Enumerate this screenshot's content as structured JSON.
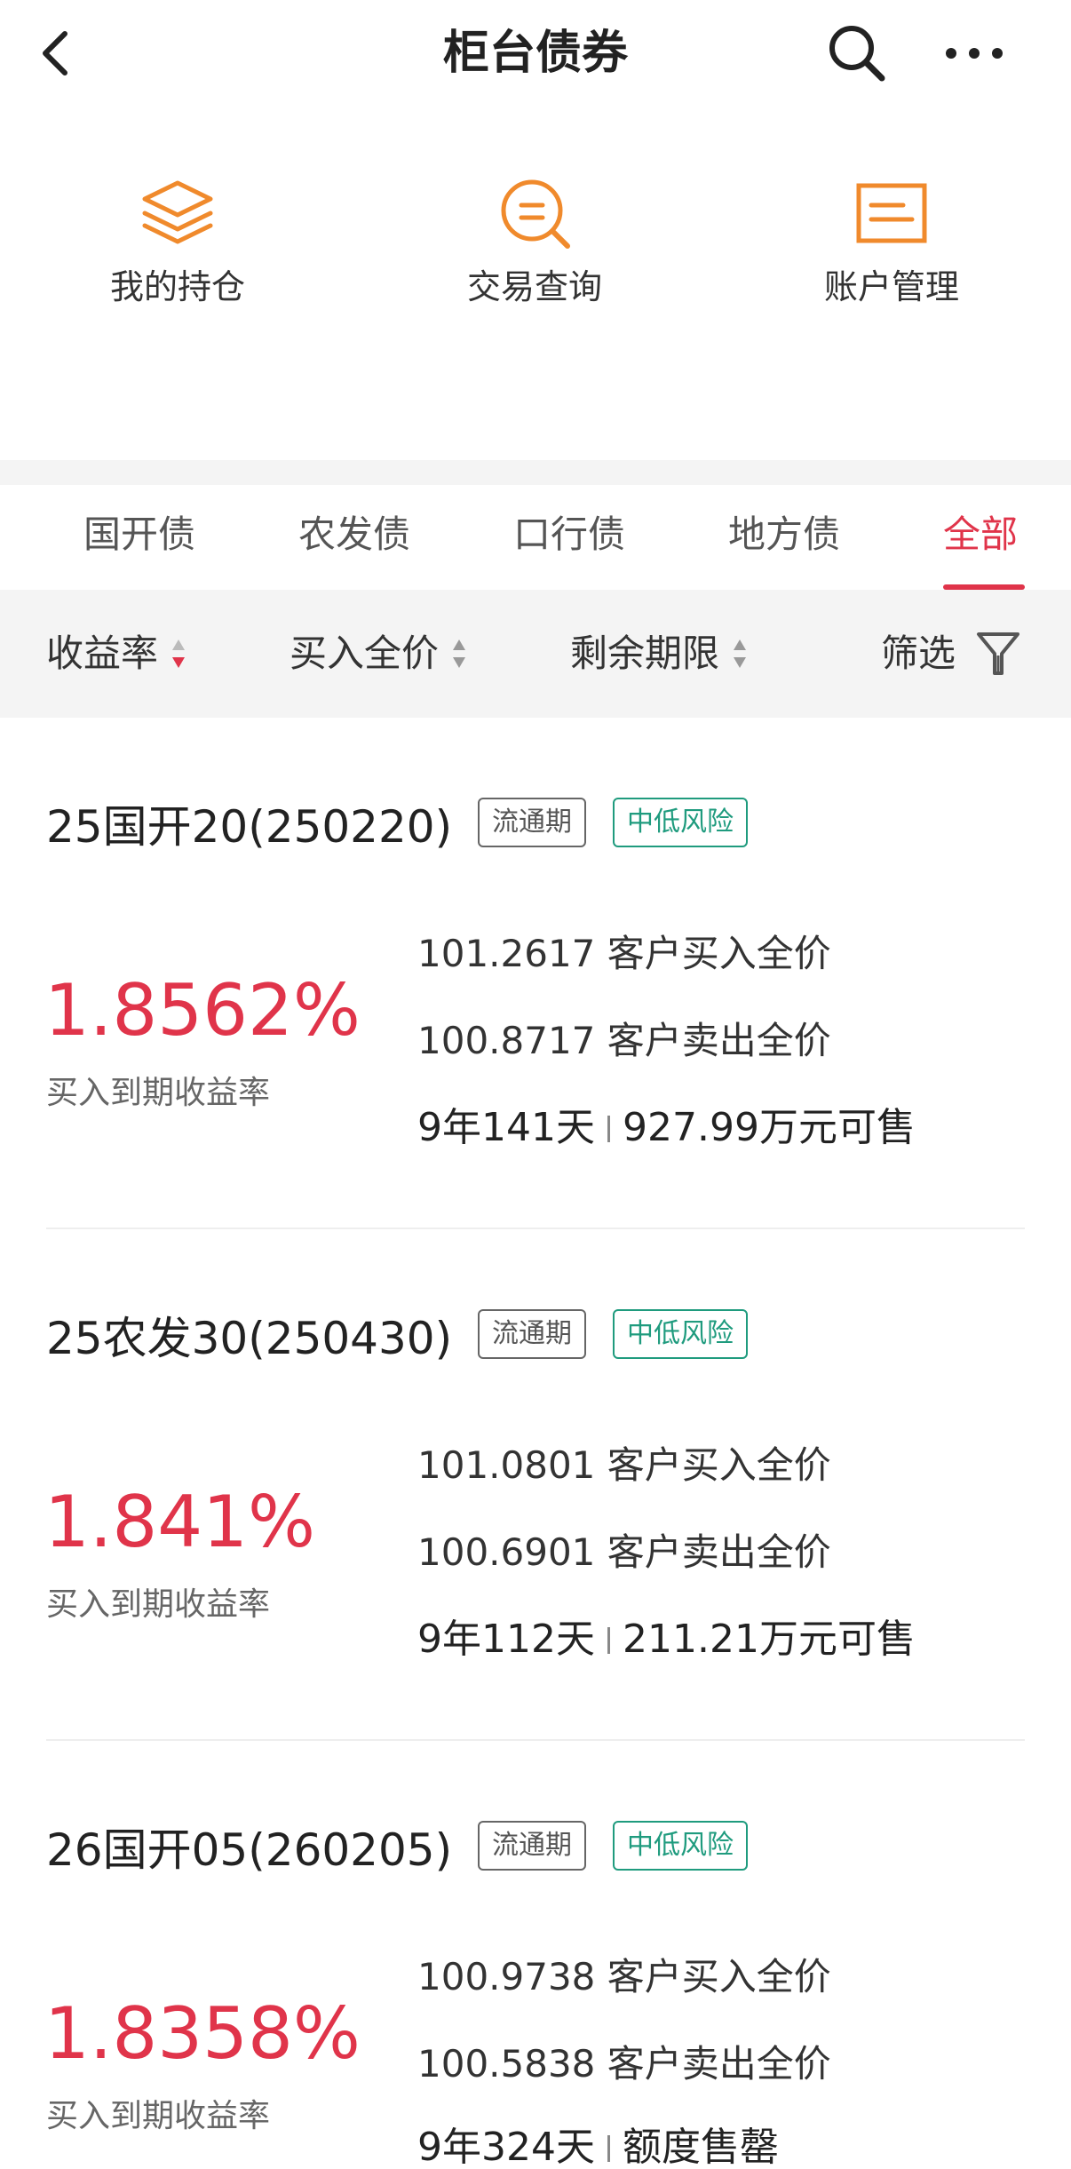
{
  "header": {
    "title": "柜台债券"
  },
  "quick_actions": [
    {
      "label": "我的持仓",
      "icon": "layers-icon"
    },
    {
      "label": "交易查询",
      "icon": "search-doc-icon"
    },
    {
      "label": "账户管理",
      "icon": "account-card-icon"
    }
  ],
  "tabs": [
    "国开债",
    "农发债",
    "口行债",
    "地方债",
    "全部"
  ],
  "active_tab": "全部",
  "sortbar": {
    "yield": "收益率",
    "price": "买入全价",
    "term": "剩余期限",
    "filter": "筛选"
  },
  "colors": {
    "accent": "#e0344a",
    "risk_green": "#1f9b7e",
    "orange_icon": "#f08a2c"
  },
  "bonds": [
    {
      "name": "25国开20(250220)",
      "tag_trade": "流通期",
      "tag_risk": "中低风险",
      "yield": "1.8562%",
      "yield_label": "买入到期收益率",
      "buy_price": "101.2617",
      "buy_label": "客户买入全价",
      "sell_price": "100.8717",
      "sell_label": "客户卖出全价",
      "term": "9年141天",
      "availability": "927.99万元可售"
    },
    {
      "name": "25农发30(250430)",
      "tag_trade": "流通期",
      "tag_risk": "中低风险",
      "yield": "1.841%",
      "yield_label": "买入到期收益率",
      "buy_price": "101.0801",
      "buy_label": "客户买入全价",
      "sell_price": "100.6901",
      "sell_label": "客户卖出全价",
      "term": "9年112天",
      "availability": "211.21万元可售"
    },
    {
      "name": "26国开05(260205)",
      "tag_trade": "流通期",
      "tag_risk": "中低风险",
      "yield": "1.8358%",
      "yield_label": "买入到期收益率",
      "buy_price": "100.9738",
      "buy_label": "客户买入全价",
      "sell_price": "100.5838",
      "sell_label": "客户卖出全价",
      "term": "9年324天",
      "availability": "额度售罄"
    }
  ]
}
